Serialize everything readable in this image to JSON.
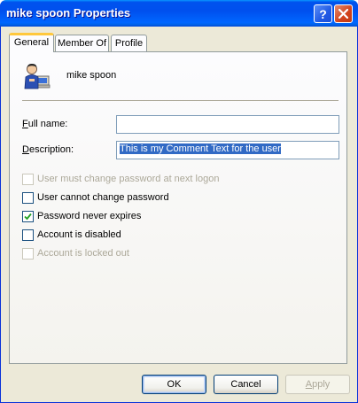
{
  "window": {
    "title": "mike spoon Properties",
    "help_glyph": "?",
    "close_glyph": "✕"
  },
  "tabs": [
    {
      "label": "General",
      "active": true
    },
    {
      "label": "Member Of",
      "active": false
    },
    {
      "label": "Profile",
      "active": false
    }
  ],
  "general": {
    "user_name": "mike spoon",
    "full_name_label": "Full name:",
    "full_name_value": "",
    "description_label": "Description:",
    "description_value": "This is my Comment Text for the user",
    "checkboxes": [
      {
        "label": "User must change password at next logon",
        "checked": false,
        "enabled": false
      },
      {
        "label": "User cannot change password",
        "checked": false,
        "enabled": true
      },
      {
        "label": "Password never expires",
        "checked": true,
        "enabled": true
      },
      {
        "label": "Account is disabled",
        "checked": false,
        "enabled": true
      },
      {
        "label": "Account is locked out",
        "checked": false,
        "enabled": false
      }
    ]
  },
  "buttons": {
    "ok": "OK",
    "cancel": "Cancel",
    "apply": "Apply"
  },
  "colors": {
    "titlebar": "#0054e3",
    "tab_highlight": "#ffc83c",
    "selection": "#316ac5"
  }
}
